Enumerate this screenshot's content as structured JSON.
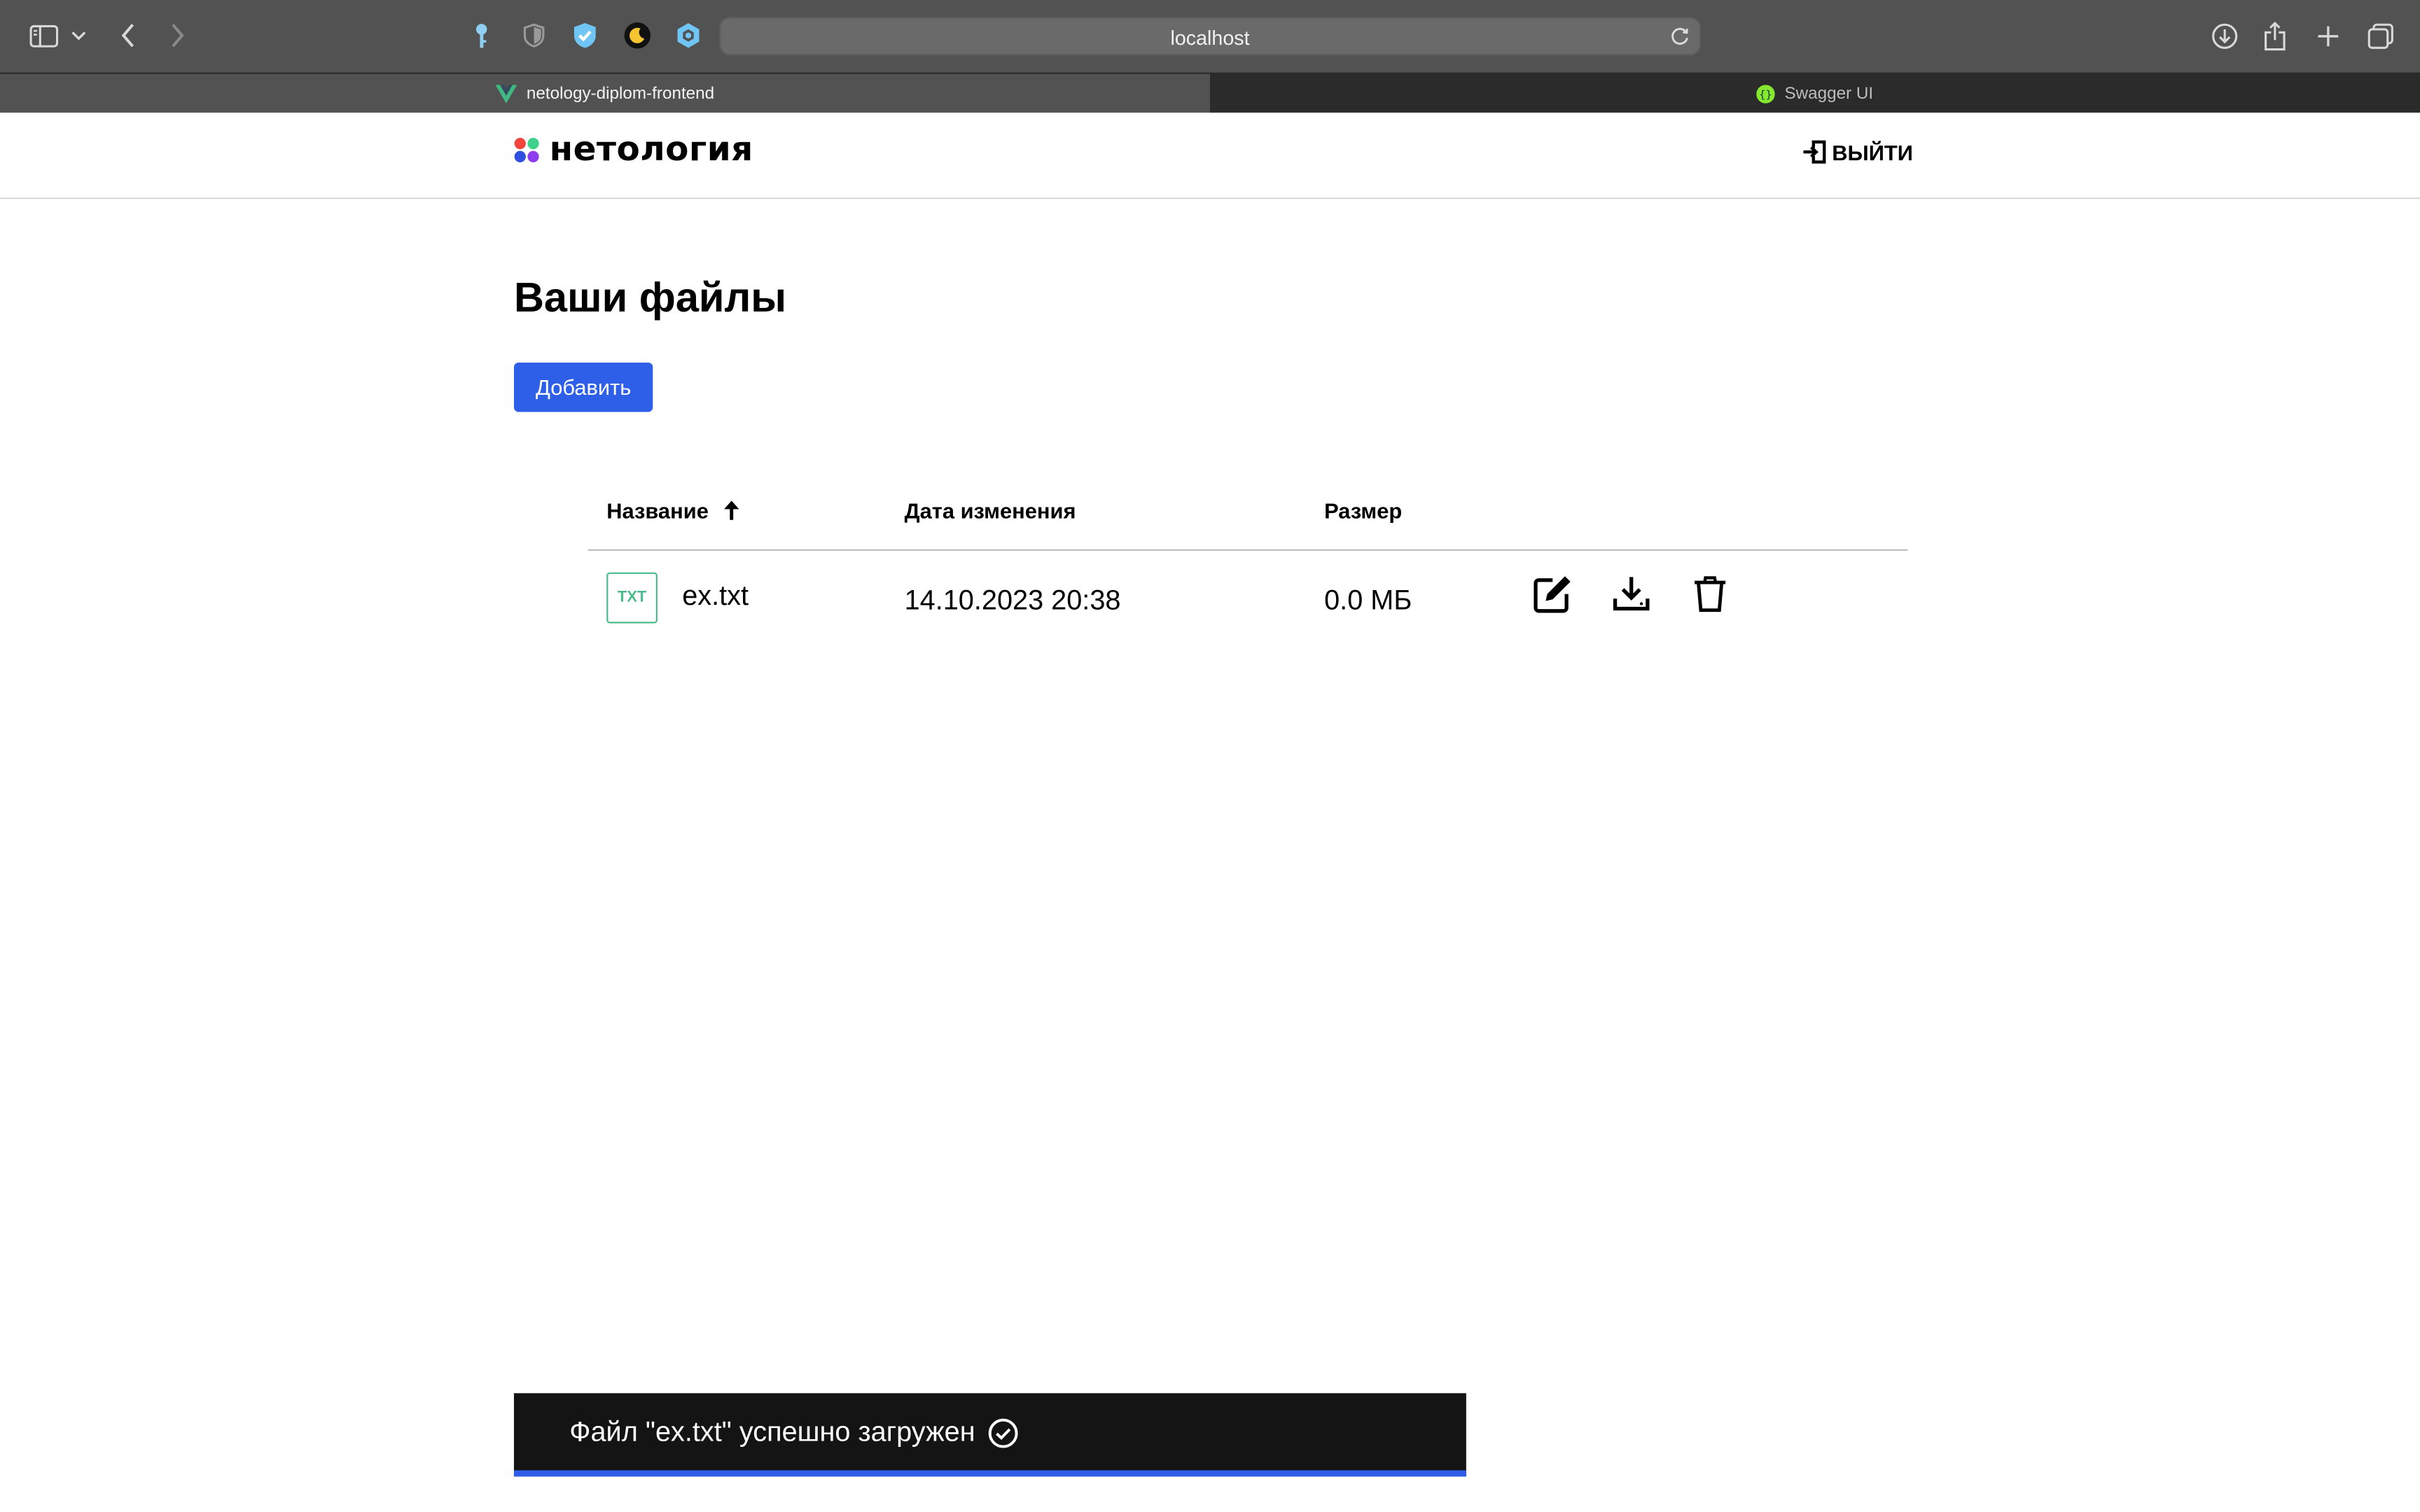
{
  "browser": {
    "address": "localhost",
    "tabs": [
      {
        "title": "netology-diplom-frontend",
        "active": true
      },
      {
        "title": "Swagger UI",
        "active": false
      }
    ]
  },
  "header": {
    "logo_text": "нетология",
    "logout_label": "ВЫЙТИ"
  },
  "main": {
    "title": "Ваши файлы",
    "add_button": "Добавить"
  },
  "table": {
    "columns": {
      "name": "Название",
      "modified": "Дата изменения",
      "size": "Размер"
    },
    "sort": {
      "column": "name",
      "direction": "asc"
    },
    "rows": [
      {
        "type_badge": "TXT",
        "name": "ex.txt",
        "modified": "14.10.2023 20:38",
        "size": "0.0 МБ"
      }
    ]
  },
  "toast": {
    "message": "Файл \"ex.txt\" успешно загружен",
    "progress": 1.0
  },
  "colors": {
    "accent": "#2e5fe8",
    "file_badge": "#4cbb8b",
    "toast_bg": "#141414"
  },
  "icons": [
    "sidebar-icon",
    "chevron-down-icon",
    "back-icon",
    "forward-icon",
    "key-icon",
    "shield-icon",
    "check-shield-icon",
    "moon-icon",
    "hexagon-icon",
    "reload-icon",
    "download-icon",
    "share-icon",
    "plus-icon",
    "tabs-icon",
    "logout-icon",
    "sort-up-icon",
    "edit-icon",
    "download-file-icon",
    "trash-icon",
    "check-circle-icon"
  ]
}
